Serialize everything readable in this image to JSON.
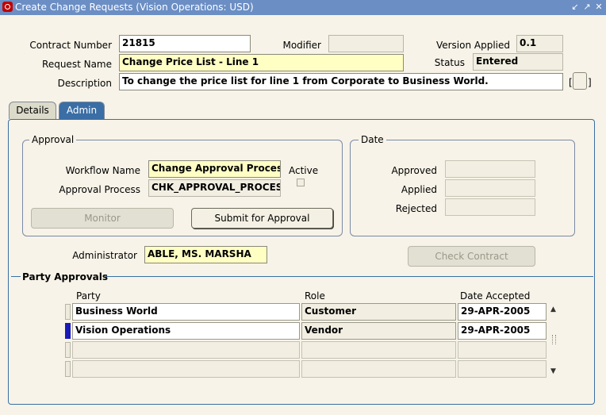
{
  "window": {
    "title": "Create Change Requests (Vision Operations: USD)",
    "controls": [
      "minimize-icon",
      "maximize-icon",
      "close-icon"
    ]
  },
  "header": {
    "contract_number_label": "Contract Number",
    "contract_number_value": "21815",
    "modifier_label": "Modifier",
    "modifier_value": "",
    "version_applied_label": "Version Applied",
    "version_applied_value": "0.1",
    "request_name_label": "Request Name",
    "request_name_value": "Change Price List - Line 1",
    "status_label": "Status",
    "status_value": "Entered",
    "description_label": "Description",
    "description_value": "To change the price list for line 1 from Corporate to Business World.",
    "dff_open": "[",
    "dff_close": "]"
  },
  "tabs": [
    {
      "label": "Details",
      "active": false
    },
    {
      "label": "Admin",
      "active": true
    }
  ],
  "approval": {
    "group_title": "Approval",
    "workflow_name_label": "Workflow Name",
    "workflow_name_value": "Change Approval Process",
    "approval_process_label": "Approval Process",
    "approval_process_value": "CHK_APPROVAL_PROCESS",
    "active_label": "Active",
    "active_checked": false,
    "monitor_label": "Monitor",
    "submit_label": "Submit for Approval"
  },
  "dates": {
    "group_title": "Date",
    "approved_label": "Approved",
    "approved_value": "",
    "applied_label": "Applied",
    "applied_value": "",
    "rejected_label": "Rejected",
    "rejected_value": ""
  },
  "administrator": {
    "label": "Administrator",
    "value": "ABLE, MS. MARSHA"
  },
  "check_contract_label": "Check Contract",
  "party_approvals": {
    "title": "Party Approvals",
    "columns": [
      "Party",
      "Role",
      "Date Accepted"
    ],
    "rows": [
      {
        "party": "Business World",
        "role": "Customer",
        "date": "29-APR-2005",
        "current": false
      },
      {
        "party": "Vision Operations",
        "role": "Vendor",
        "date": "29-APR-2005",
        "current": true
      },
      {
        "party": "",
        "role": "",
        "date": "",
        "current": false
      },
      {
        "party": "",
        "role": "",
        "date": "",
        "current": false
      }
    ]
  },
  "colors": {
    "titlebar": "#6b8ec4",
    "background": "#f7f3e8",
    "required_field": "#ffffc4",
    "active_tab": "#3a6ea5",
    "current_row": "#1a1ab8"
  }
}
